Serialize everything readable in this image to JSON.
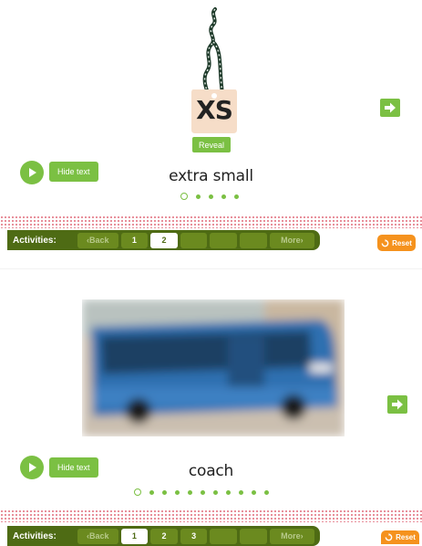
{
  "panel1": {
    "tag_text": "XS",
    "reveal_label": "Reveal",
    "hide_text_label": "Hide text",
    "word": "extra small",
    "dots_total": 5,
    "dots_active_index": 0,
    "activities": {
      "label": "Activities:",
      "back_label": "‹Back",
      "pages": [
        "1",
        "2"
      ],
      "current_page": "2",
      "more_label": "More›"
    },
    "reset_label": "Reset"
  },
  "panel2": {
    "hide_text_label": "Hide text",
    "word": "coach",
    "dots_total": 11,
    "dots_active_index": 0,
    "activities": {
      "label": "Activities:",
      "back_label": "‹Back",
      "pages": [
        "1",
        "2",
        "3"
      ],
      "current_page": "1",
      "more_label": "More›"
    },
    "reset_label": "Reset"
  },
  "colors": {
    "green": "#7bc043",
    "bar_dark": "#4e6b14",
    "orange": "#f5921e",
    "dotted": "#e06b7a"
  },
  "icons": {
    "next": "arrow-right-icon",
    "play": "play-icon",
    "reset": "reset-icon"
  }
}
